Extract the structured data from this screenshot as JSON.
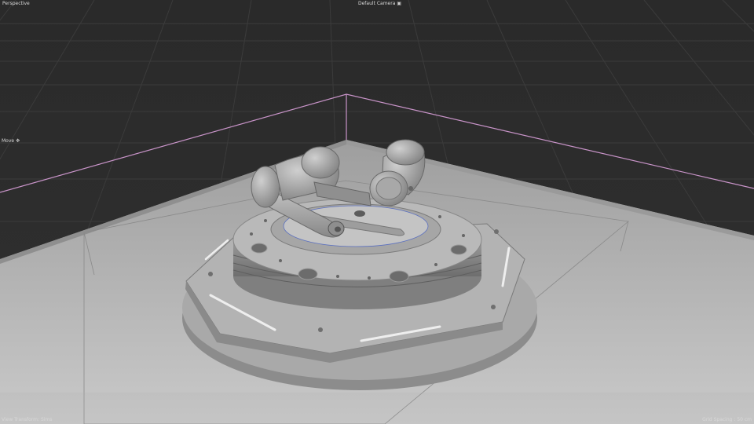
{
  "viewport": {
    "projection_label": "Perspective",
    "camera_label": "Default Camera",
    "camera_icon": "camera-icon",
    "tool_label": "Move",
    "tool_icon": "move-icon",
    "view_transform_prefix": "View Transform:",
    "view_transform_value": "Sims",
    "grid_spacing_prefix": "Grid Spacing :",
    "grid_spacing_value": "50 cm"
  },
  "colors": {
    "background": "#2b2b2b",
    "grid_line": "#3a3a3a",
    "selection_outline": "#c994c9",
    "model_fill": "#a9a9a9",
    "model_shadow": "#7e7e7e",
    "platform_fill": "#b6b6b6"
  }
}
